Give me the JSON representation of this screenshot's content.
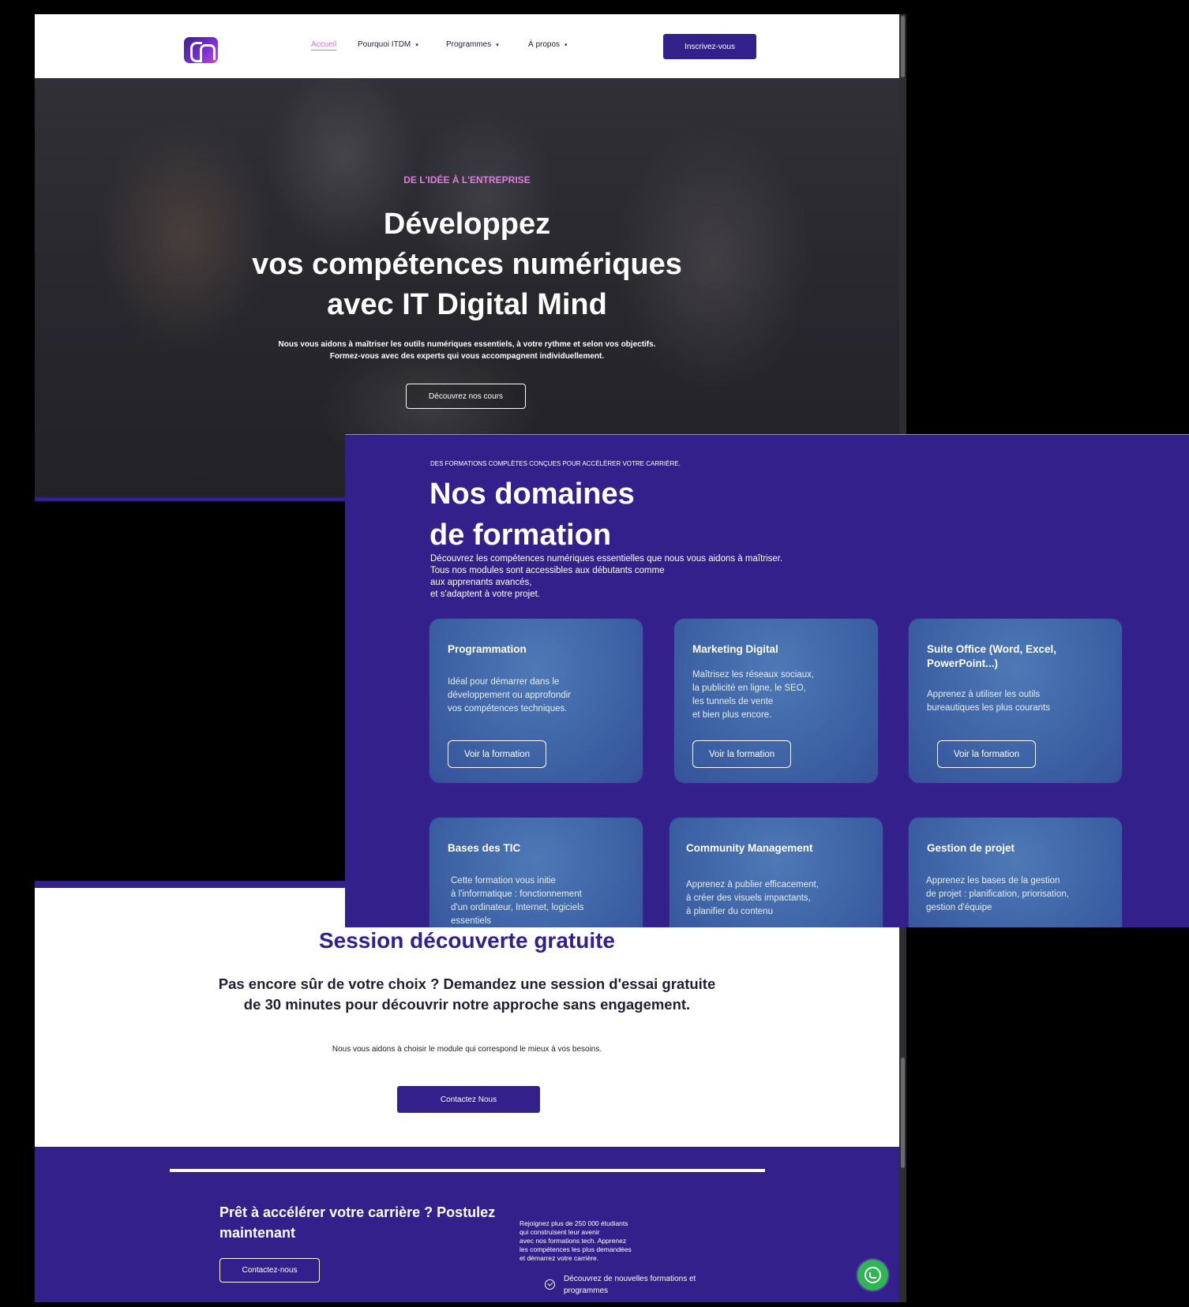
{
  "nav": {
    "items": [
      {
        "label": "Accueil",
        "active": true
      },
      {
        "label": "Pourquoi ITDM",
        "caret": "▾"
      },
      {
        "label": "Programmes",
        "caret": "▾"
      },
      {
        "label": "À propos",
        "caret": "▾"
      }
    ],
    "cta": "Inscrivez-vous"
  },
  "hero": {
    "kicker": "DE L'IDÉE À L'ENTREPRISE",
    "title_line1": "Développez",
    "title_line2": "vos compétences numériques",
    "title_line3": "avec IT Digital Mind",
    "subtitle_line1": "Nous vous aidons à maîtriser les outils numériques essentiels, à votre rythme et selon vos objectifs.",
    "subtitle_line2": "Formez-vous avec des experts qui vous accompagnent individuellement.",
    "button": "Découvrez nos cours"
  },
  "domains": {
    "kicker": "DES FORMATIONS COMPLÈTES CONÇUES POUR ACCÉLÉRER VOTRE CARRIÈRE.",
    "title_line1": "Nos domaines",
    "title_line2": "de formation",
    "desc_line1": "Découvrez les compétences numériques essentielles que nous vous aidons à maîtriser.",
    "desc_line2": "Tous nos modules sont accessibles aux débutants comme",
    "desc_line3": "aux apprenants avancés,",
    "desc_line4": "et s'adaptent à votre projet.",
    "cards": [
      {
        "title": "Programmation",
        "text": [
          "Idéal pour démarrer dans le",
          "développement ou approfondir",
          "vos compétences techniques."
        ],
        "button": "Voir la formation"
      },
      {
        "title": "Marketing Digital",
        "text": [
          "Maîtrisez les réseaux sociaux,",
          "la publicité en ligne, le SEO,",
          "les tunnels de vente",
          "et bien plus encore."
        ],
        "button": "Voir la formation"
      },
      {
        "title": "Suite Office (Word, Excel, PowerPoint...)",
        "text": [
          "Apprenez à utiliser les outils",
          "bureautiques les plus courants"
        ],
        "button": "Voir la formation"
      },
      {
        "title": "Bases des TIC",
        "text": [
          "Cette formation vous initie",
          "à l'informatique : fonctionnement",
          "d'un ordinateur, Internet, logiciels",
          "essentiels"
        ]
      },
      {
        "title": "Community Management",
        "text": [
          "Apprenez à publier efficacement,",
          "à créer des visuels impactants,",
          "à planifier du contenu"
        ]
      },
      {
        "title": "Gestion de projet",
        "text": [
          "Apprenez les bases de la gestion",
          "de projet : planification, priorisation,",
          "gestion d'équipe"
        ]
      }
    ]
  },
  "session": {
    "title": "Session découverte gratuite",
    "sub_line1": "Pas encore sûr de votre choix ? Demandez une session d'essai gratuite",
    "sub_line2": "de 30 minutes pour découvrir notre approche sans engagement.",
    "note": "Nous vous aidons à choisir le module qui correspond le mieux à vos besoins.",
    "button": "Contactez Nous"
  },
  "cta": {
    "title_line1": "Prêt à accélérer votre carrière ? Postulez",
    "title_line2": "maintenant",
    "button": "Contactez-nous",
    "text": [
      "Rejoignez plus de 250 000 étudiants",
      "qui construisent leur avenir",
      "avec nos formations tech. Apprenez",
      "les compétences les plus demandées",
      "et démarrez votre carrière."
    ],
    "check_item_line1": "Découvrez de nouvelles formations et",
    "check_item_line2": "programmes"
  },
  "colors": {
    "brand": "#34208b",
    "accent_pink": "#e07de0",
    "card_blue": "#3e64a6",
    "whatsapp_green": "#2fb554"
  },
  "icons": [
    "logo-icon",
    "caret-down-icon",
    "check-circle-icon",
    "whatsapp-icon"
  ]
}
